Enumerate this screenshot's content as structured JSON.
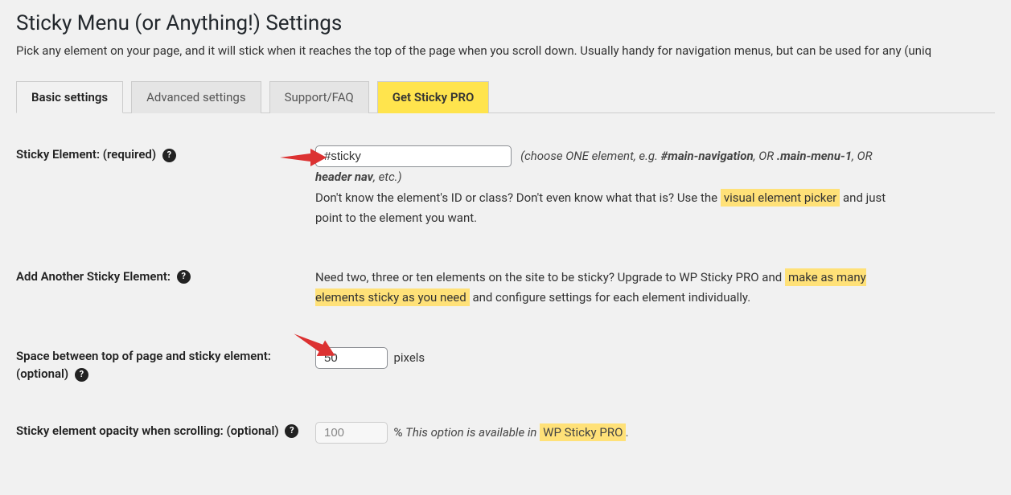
{
  "page": {
    "title": "Sticky Menu (or Anything!) Settings",
    "intro": "Pick any element on your page, and it will stick when it reaches the top of the page when you scroll down. Usually handy for navigation menus, but can be used for any (uniq"
  },
  "tabs": {
    "basic": "Basic settings",
    "advanced": "Advanced settings",
    "support": "Support/FAQ",
    "pro": "Get Sticky PRO"
  },
  "row1": {
    "label": "Sticky Element: (required)",
    "input_value": "#sticky",
    "hint_pre": "(choose ONE element, e.g. ",
    "hint_b1": "#main-navigation",
    "hint_or1": ", OR ",
    "hint_b2": ".main-menu-1",
    "hint_or2": ", OR ",
    "hint_b3": "header nav",
    "hint_post": ", etc.)",
    "line2_a": "Don't know the element's ID or class? Don't even know what that is? Use the ",
    "line2_hl": "visual element picker",
    "line2_b": " and just point to the element you want."
  },
  "row2": {
    "label": "Add Another Sticky Element:",
    "text_a": "Need two, three or ten elements on the site to be sticky? Upgrade to WP Sticky PRO and ",
    "text_hl": "make as many elements sticky as you need",
    "text_b": " and configure settings for each element individually."
  },
  "row3": {
    "label": "Space between top of page and sticky element: (optional)",
    "input_value": "50",
    "unit": "pixels"
  },
  "row4": {
    "label": "Sticky element opacity when scrolling: (optional)",
    "input_value": "100",
    "pct": "% ",
    "hint_a": "This option is available in ",
    "hint_hl": "WP Sticky PRO",
    "hint_b": "."
  }
}
